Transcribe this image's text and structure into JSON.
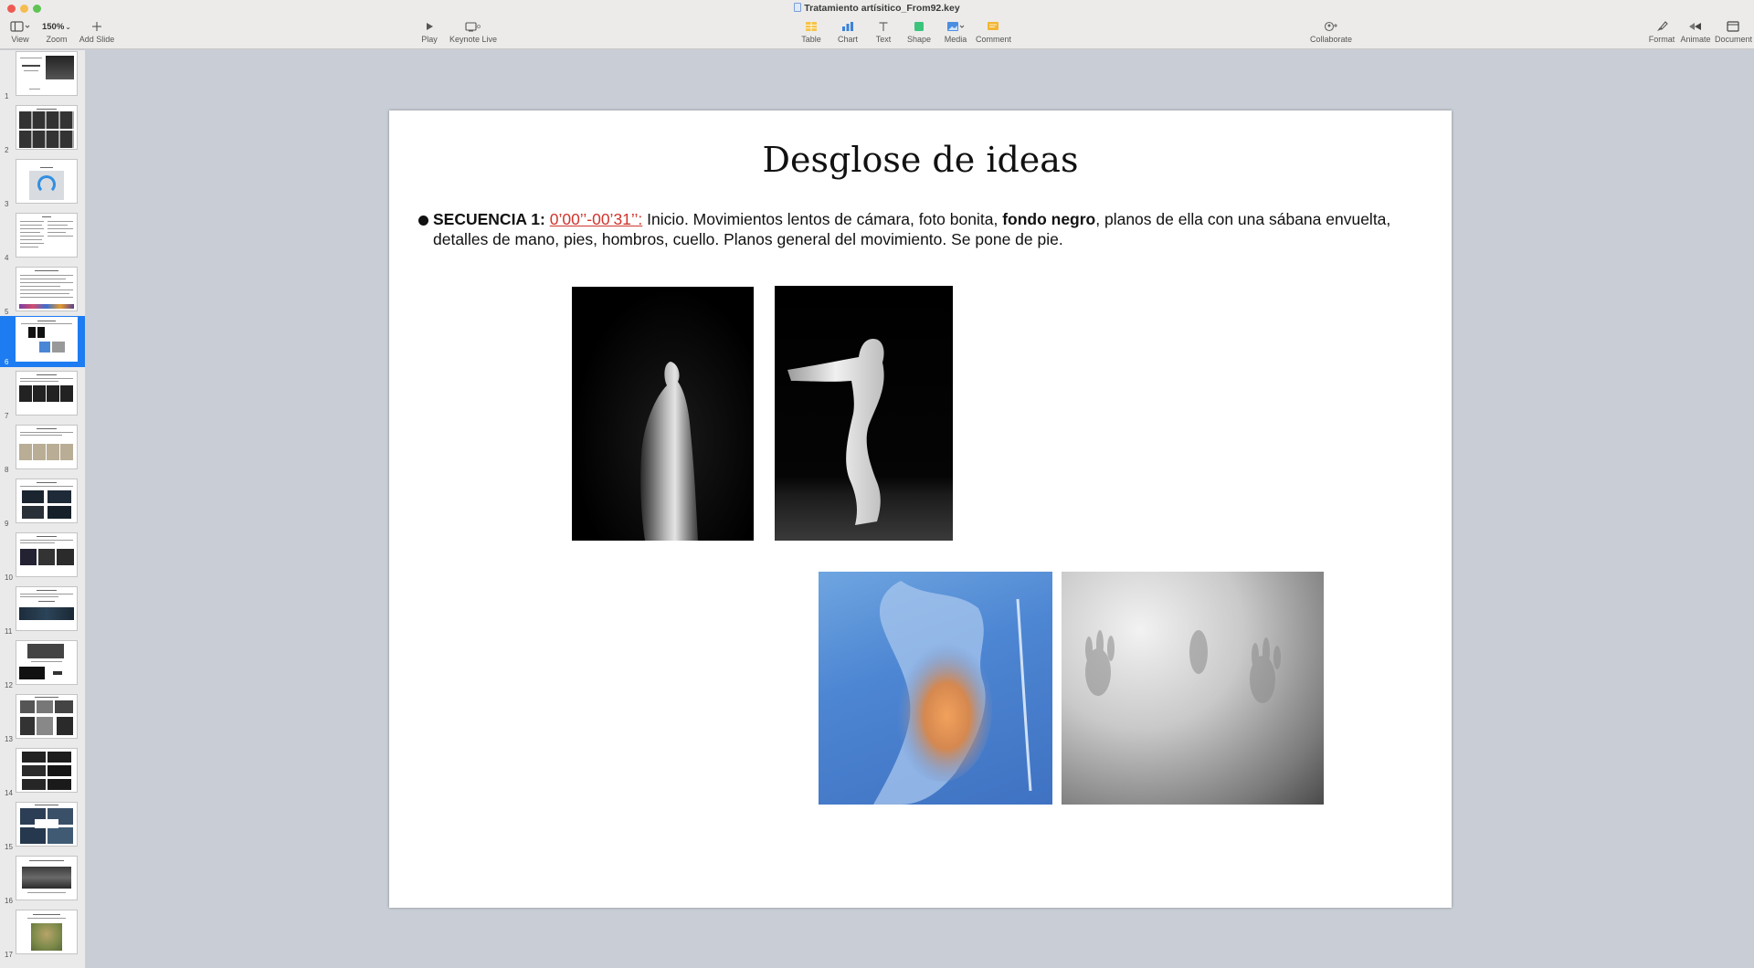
{
  "window": {
    "title": "Tratamiento artísitico_From92.key"
  },
  "toolbar": {
    "view_label": "View",
    "zoom_value": "150%",
    "zoom_label": "Zoom",
    "add_slide_label": "Add Slide",
    "play_label": "Play",
    "keynote_live_label": "Keynote Live",
    "table_label": "Table",
    "chart_label": "Chart",
    "text_label": "Text",
    "shape_label": "Shape",
    "media_label": "Media",
    "comment_label": "Comment",
    "collaborate_label": "Collaborate",
    "format_label": "Format",
    "animate_label": "Animate",
    "document_label": "Document"
  },
  "sidebar": {
    "selected_slide": 6,
    "slides": [
      "1",
      "2",
      "3",
      "4",
      "5",
      "6",
      "7",
      "8",
      "9",
      "10",
      "11",
      "12",
      "13",
      "14",
      "15",
      "16",
      "17"
    ]
  },
  "slide": {
    "title": "Desglose de ideas",
    "bullet": {
      "label": "SECUENCIA 1:",
      "time": "0’00’’-00’31’’:",
      "text_1": " Inicio. Movimientos lentos de cámara, foto bonita, ",
      "bold_2": "fondo negro",
      "text_3": ", planos de ella con una sábana envuelta, detalles de mano, pies, hombros, cuello. Planos general del movimiento. Se pone de pie."
    }
  },
  "colors": {
    "accent_selected": "#1d7cf2",
    "link_red": "#d0342c"
  }
}
